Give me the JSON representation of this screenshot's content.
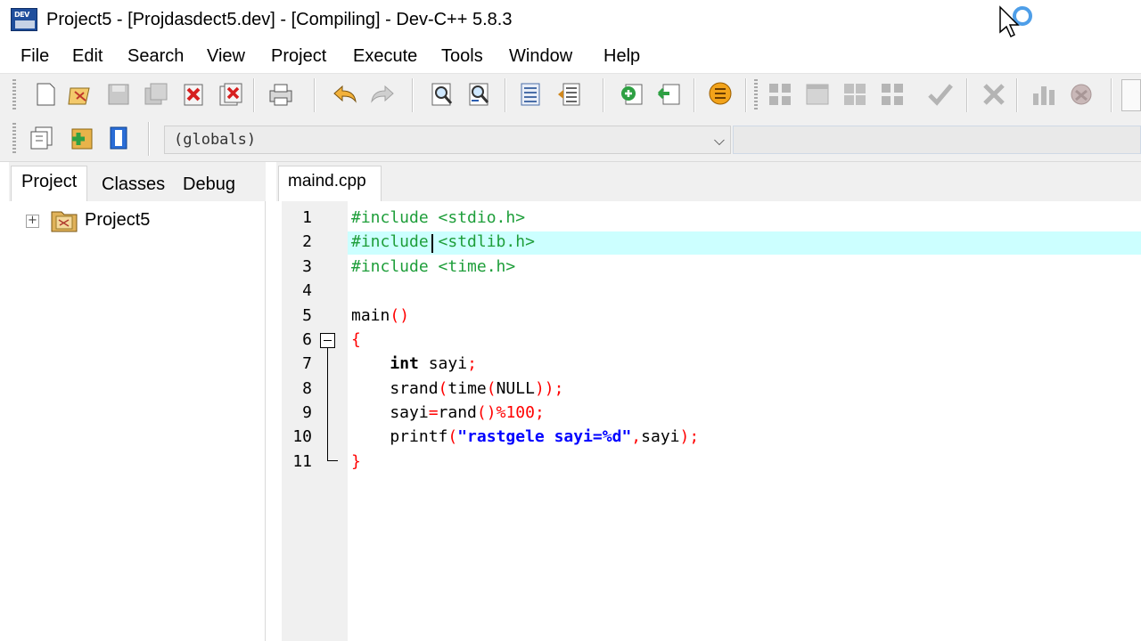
{
  "window": {
    "title": "Project5 - [Projdasdect5.dev] - [Compiling] - Dev-C++ 5.8.3",
    "app_icon_text": "DEV"
  },
  "menu": [
    "File",
    "Edit",
    "Search",
    "View",
    "Project",
    "Execute",
    "Tools",
    "Window",
    "Help"
  ],
  "toolbar": {
    "scope_combo": "(globals)",
    "scope_combo_arrow": "chevron-down-icon",
    "toolbar1_icons": [
      "new-file-icon",
      "open-project-icon",
      "save-icon",
      "save-all-icon",
      "close-icon",
      "close-all-icon",
      "print-icon",
      "undo-icon",
      "redo-icon",
      "find-icon",
      "replace-icon",
      "indent-icon",
      "unindent-icon",
      "goto-add-icon",
      "goto-remove-icon",
      "bookmark-icon",
      "compile-icon",
      "run-icon",
      "compile-run-icon",
      "rebuild-icon",
      "check-icon",
      "stop-icon",
      "chart-icon",
      "profile-icon"
    ],
    "toolbar2_icons": [
      "new-class-icon",
      "add-file-icon",
      "project-options-icon"
    ]
  },
  "left_panel": {
    "tabs": [
      "Project",
      "Classes",
      "Debug"
    ],
    "active_tab": "Project",
    "tree": [
      {
        "label": "Project5",
        "expanded": false
      }
    ]
  },
  "editor": {
    "tab": "maind.cpp",
    "highlighted_line": 2,
    "lines": [
      {
        "n": "1",
        "text": "#include <stdio.h>"
      },
      {
        "n": "2",
        "text": "#include <stdlib.h>"
      },
      {
        "n": "3",
        "text": "#include <time.h>"
      },
      {
        "n": "4",
        "text": ""
      },
      {
        "n": "5",
        "text": "main()"
      },
      {
        "n": "6",
        "text": "{"
      },
      {
        "n": "7",
        "text": "    int sayi;"
      },
      {
        "n": "8",
        "text": "    srand(time(NULL));"
      },
      {
        "n": "9",
        "text": "    sayi=rand()%100;"
      },
      {
        "n": "10",
        "text": "    printf(\"rastgele sayi=%d\",sayi);"
      },
      {
        "n": "11",
        "text": "}"
      }
    ]
  },
  "colors": {
    "preprocessor": "#1e9e3a",
    "symbol": "#ff0000",
    "string": "#0000ff",
    "current_line": "#ccffff"
  }
}
